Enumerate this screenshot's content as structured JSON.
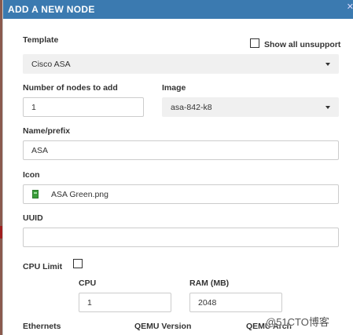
{
  "dialog": {
    "title": "ADD A NEW NODE",
    "close_label": "✕"
  },
  "form": {
    "template_label": "Template",
    "show_all_label": "Show all unsupport",
    "template_value": "Cisco ASA",
    "nodes_label": "Number of nodes to add",
    "nodes_value": "1",
    "image_label": "Image",
    "image_value": "asa-842-k8",
    "name_label": "Name/prefix",
    "name_value": "ASA",
    "icon_label": "Icon",
    "icon_value": "ASA Green.png",
    "uuid_label": "UUID",
    "uuid_value": "",
    "cpu_limit_label": "CPU Limit",
    "cpu_label": "CPU",
    "cpu_value": "1",
    "ram_label": "RAM (MB)",
    "ram_value": "2048",
    "ethernets_label": "Ethernets",
    "qemu_version_label": "QEMU Version",
    "qemu_arch_label": "QEMU Arch"
  },
  "watermark": "@51CTO博客",
  "colors": {
    "header_bg": "#3b7ab0",
    "select_bg": "#f0f0f0"
  }
}
